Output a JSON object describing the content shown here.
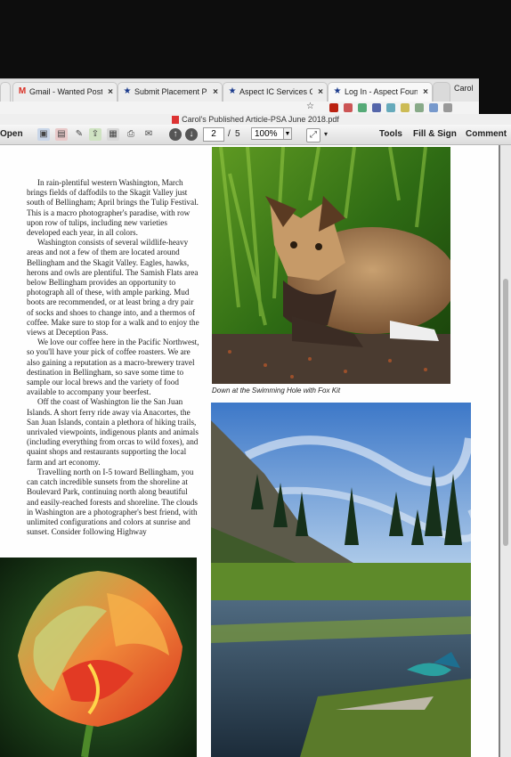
{
  "browser": {
    "tabs": [
      {
        "label": "Gmail - Wanted Poster",
        "icon": "gmail-icon"
      },
      {
        "label": "Submit Placement Pape",
        "icon": "star-logo-icon"
      },
      {
        "label": "Aspect IC Services Cen",
        "icon": "star-logo-icon"
      },
      {
        "label": "Log In - Aspect Foundati",
        "icon": "star-logo-icon"
      }
    ],
    "profile_name": "Carol"
  },
  "document": {
    "title": "Carol's Published Article-PSA June 2018.pdf"
  },
  "toolbar": {
    "open_label": "Open",
    "current_page": "2",
    "page_separator": "/",
    "total_pages": "5",
    "zoom": "100%",
    "tools_label": "Tools",
    "fill_sign_label": "Fill & Sign",
    "comment_label": "Comment"
  },
  "article": {
    "paragraphs": [
      "In rain-plentiful western Washington, March brings fields of daffodils to the Skagit Valley just south of Bellingham; April brings the Tulip Festival. This is a macro photographer's paradise, with row upon row of tulips, including new varieties developed each year, in all colors.",
      "Washington consists of several wildlife-heavy areas and not a few of them are located around Bellingham and the Skagit Valley. Eagles, hawks, herons and owls are plentiful. The Samish Flats area below Bellingham provides an opportunity to photograph all of these, with ample parking. Mud boots are recommended, or at least bring a dry pair of socks and shoes to change into, and a thermos of coffee. Make sure to stop for a walk and to enjoy the views at Deception Pass.",
      "We love our coffee here in the Pacific Northwest, so you'll have your pick of coffee roasters. We are also gaining a reputation as a macro-brewery travel destination in Bellingham, so save some time to sample our local brews and the variety of food available to accompany your beerfest.",
      "Off the coast of Washington lie the San Juan Islands. A short ferry ride away via Anacortes, the San Juan Islands, contain a plethora of hiking trails, unrivaled viewpoints, indigenous plants and animals (including everything from orcas to wild foxes), and quaint shops and restaurants supporting the local farm and art economy.",
      "Travelling north on I-5 toward Bellingham, you can catch incredible sunsets from the shoreline at Boulevard Park, continuing north along beautiful and easily-reached forests and shoreline. The clouds in Washington are a photographer's best friend, with unlimited configurations and colors at sunrise and sunset. Consider following Highway"
    ]
  },
  "figures": {
    "fox_caption": "Down at the Swimming Hole with Fox Kit"
  },
  "colors": {
    "toolbar_bg": "#dcdcdc",
    "page_bg": "#fefefe",
    "chrome_bg": "#e4e4e4"
  }
}
